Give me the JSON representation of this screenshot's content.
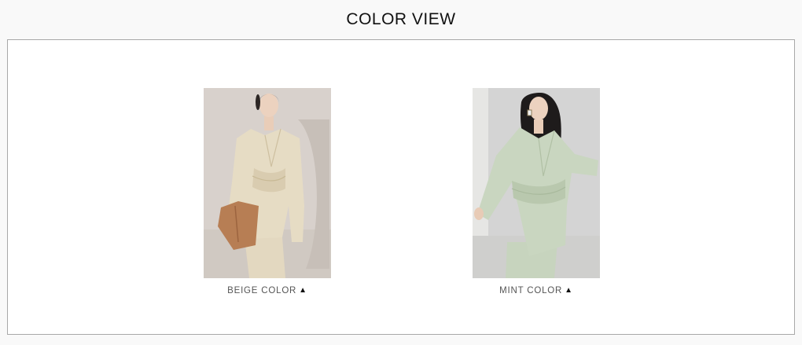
{
  "page_title": "COLOR VIEW",
  "colors": [
    {
      "label": "BEIGE COLOR",
      "icon": "triangle-up-icon",
      "garment_color": "#e6dcc4",
      "backdrop_color": "#d6d0cc"
    },
    {
      "label": "MINT COLOR",
      "icon": "triangle-up-icon",
      "garment_color": "#c9d6c0",
      "backdrop_color": "#d4d4d4"
    }
  ],
  "theme": {
    "page_background": "#f9f9f9",
    "frame_border": "#a8a8a8"
  }
}
